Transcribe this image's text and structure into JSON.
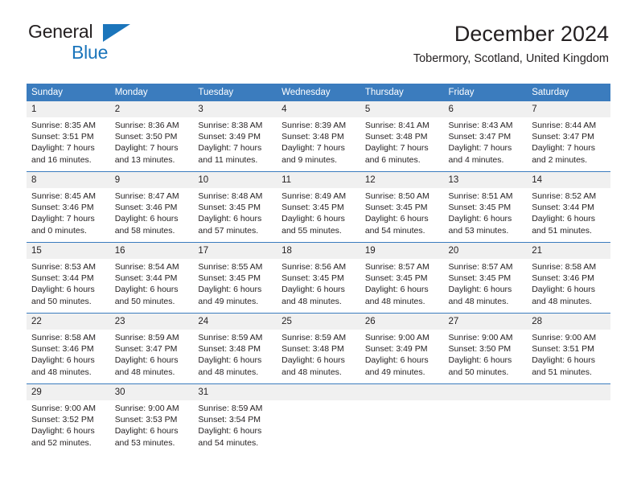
{
  "brand": {
    "name_part1": "General",
    "name_part2": "Blue",
    "accent_color": "#1b75bb"
  },
  "header": {
    "title": "December 2024",
    "subtitle": "Tobermory, Scotland, United Kingdom",
    "header_bg_color": "#3b7cbe",
    "daynum_bg_color": "#f0f0f0"
  },
  "weekdays": [
    "Sunday",
    "Monday",
    "Tuesday",
    "Wednesday",
    "Thursday",
    "Friday",
    "Saturday"
  ],
  "weeks": [
    {
      "days": [
        {
          "num": "1",
          "sunrise": "Sunrise: 8:35 AM",
          "sunset": "Sunset: 3:51 PM",
          "daylight_1": "Daylight: 7 hours",
          "daylight_2": "and 16 minutes."
        },
        {
          "num": "2",
          "sunrise": "Sunrise: 8:36 AM",
          "sunset": "Sunset: 3:50 PM",
          "daylight_1": "Daylight: 7 hours",
          "daylight_2": "and 13 minutes."
        },
        {
          "num": "3",
          "sunrise": "Sunrise: 8:38 AM",
          "sunset": "Sunset: 3:49 PM",
          "daylight_1": "Daylight: 7 hours",
          "daylight_2": "and 11 minutes."
        },
        {
          "num": "4",
          "sunrise": "Sunrise: 8:39 AM",
          "sunset": "Sunset: 3:48 PM",
          "daylight_1": "Daylight: 7 hours",
          "daylight_2": "and 9 minutes."
        },
        {
          "num": "5",
          "sunrise": "Sunrise: 8:41 AM",
          "sunset": "Sunset: 3:48 PM",
          "daylight_1": "Daylight: 7 hours",
          "daylight_2": "and 6 minutes."
        },
        {
          "num": "6",
          "sunrise": "Sunrise: 8:43 AM",
          "sunset": "Sunset: 3:47 PM",
          "daylight_1": "Daylight: 7 hours",
          "daylight_2": "and 4 minutes."
        },
        {
          "num": "7",
          "sunrise": "Sunrise: 8:44 AM",
          "sunset": "Sunset: 3:47 PM",
          "daylight_1": "Daylight: 7 hours",
          "daylight_2": "and 2 minutes."
        }
      ]
    },
    {
      "days": [
        {
          "num": "8",
          "sunrise": "Sunrise: 8:45 AM",
          "sunset": "Sunset: 3:46 PM",
          "daylight_1": "Daylight: 7 hours",
          "daylight_2": "and 0 minutes."
        },
        {
          "num": "9",
          "sunrise": "Sunrise: 8:47 AM",
          "sunset": "Sunset: 3:46 PM",
          "daylight_1": "Daylight: 6 hours",
          "daylight_2": "and 58 minutes."
        },
        {
          "num": "10",
          "sunrise": "Sunrise: 8:48 AM",
          "sunset": "Sunset: 3:45 PM",
          "daylight_1": "Daylight: 6 hours",
          "daylight_2": "and 57 minutes."
        },
        {
          "num": "11",
          "sunrise": "Sunrise: 8:49 AM",
          "sunset": "Sunset: 3:45 PM",
          "daylight_1": "Daylight: 6 hours",
          "daylight_2": "and 55 minutes."
        },
        {
          "num": "12",
          "sunrise": "Sunrise: 8:50 AM",
          "sunset": "Sunset: 3:45 PM",
          "daylight_1": "Daylight: 6 hours",
          "daylight_2": "and 54 minutes."
        },
        {
          "num": "13",
          "sunrise": "Sunrise: 8:51 AM",
          "sunset": "Sunset: 3:45 PM",
          "daylight_1": "Daylight: 6 hours",
          "daylight_2": "and 53 minutes."
        },
        {
          "num": "14",
          "sunrise": "Sunrise: 8:52 AM",
          "sunset": "Sunset: 3:44 PM",
          "daylight_1": "Daylight: 6 hours",
          "daylight_2": "and 51 minutes."
        }
      ]
    },
    {
      "days": [
        {
          "num": "15",
          "sunrise": "Sunrise: 8:53 AM",
          "sunset": "Sunset: 3:44 PM",
          "daylight_1": "Daylight: 6 hours",
          "daylight_2": "and 50 minutes."
        },
        {
          "num": "16",
          "sunrise": "Sunrise: 8:54 AM",
          "sunset": "Sunset: 3:44 PM",
          "daylight_1": "Daylight: 6 hours",
          "daylight_2": "and 50 minutes."
        },
        {
          "num": "17",
          "sunrise": "Sunrise: 8:55 AM",
          "sunset": "Sunset: 3:45 PM",
          "daylight_1": "Daylight: 6 hours",
          "daylight_2": "and 49 minutes."
        },
        {
          "num": "18",
          "sunrise": "Sunrise: 8:56 AM",
          "sunset": "Sunset: 3:45 PM",
          "daylight_1": "Daylight: 6 hours",
          "daylight_2": "and 48 minutes."
        },
        {
          "num": "19",
          "sunrise": "Sunrise: 8:57 AM",
          "sunset": "Sunset: 3:45 PM",
          "daylight_1": "Daylight: 6 hours",
          "daylight_2": "and 48 minutes."
        },
        {
          "num": "20",
          "sunrise": "Sunrise: 8:57 AM",
          "sunset": "Sunset: 3:45 PM",
          "daylight_1": "Daylight: 6 hours",
          "daylight_2": "and 48 minutes."
        },
        {
          "num": "21",
          "sunrise": "Sunrise: 8:58 AM",
          "sunset": "Sunset: 3:46 PM",
          "daylight_1": "Daylight: 6 hours",
          "daylight_2": "and 48 minutes."
        }
      ]
    },
    {
      "days": [
        {
          "num": "22",
          "sunrise": "Sunrise: 8:58 AM",
          "sunset": "Sunset: 3:46 PM",
          "daylight_1": "Daylight: 6 hours",
          "daylight_2": "and 48 minutes."
        },
        {
          "num": "23",
          "sunrise": "Sunrise: 8:59 AM",
          "sunset": "Sunset: 3:47 PM",
          "daylight_1": "Daylight: 6 hours",
          "daylight_2": "and 48 minutes."
        },
        {
          "num": "24",
          "sunrise": "Sunrise: 8:59 AM",
          "sunset": "Sunset: 3:48 PM",
          "daylight_1": "Daylight: 6 hours",
          "daylight_2": "and 48 minutes."
        },
        {
          "num": "25",
          "sunrise": "Sunrise: 8:59 AM",
          "sunset": "Sunset: 3:48 PM",
          "daylight_1": "Daylight: 6 hours",
          "daylight_2": "and 48 minutes."
        },
        {
          "num": "26",
          "sunrise": "Sunrise: 9:00 AM",
          "sunset": "Sunset: 3:49 PM",
          "daylight_1": "Daylight: 6 hours",
          "daylight_2": "and 49 minutes."
        },
        {
          "num": "27",
          "sunrise": "Sunrise: 9:00 AM",
          "sunset": "Sunset: 3:50 PM",
          "daylight_1": "Daylight: 6 hours",
          "daylight_2": "and 50 minutes."
        },
        {
          "num": "28",
          "sunrise": "Sunrise: 9:00 AM",
          "sunset": "Sunset: 3:51 PM",
          "daylight_1": "Daylight: 6 hours",
          "daylight_2": "and 51 minutes."
        }
      ]
    },
    {
      "days": [
        {
          "num": "29",
          "sunrise": "Sunrise: 9:00 AM",
          "sunset": "Sunset: 3:52 PM",
          "daylight_1": "Daylight: 6 hours",
          "daylight_2": "and 52 minutes."
        },
        {
          "num": "30",
          "sunrise": "Sunrise: 9:00 AM",
          "sunset": "Sunset: 3:53 PM",
          "daylight_1": "Daylight: 6 hours",
          "daylight_2": "and 53 minutes."
        },
        {
          "num": "31",
          "sunrise": "Sunrise: 8:59 AM",
          "sunset": "Sunset: 3:54 PM",
          "daylight_1": "Daylight: 6 hours",
          "daylight_2": "and 54 minutes."
        },
        {
          "num": "",
          "sunrise": "",
          "sunset": "",
          "daylight_1": "",
          "daylight_2": ""
        },
        {
          "num": "",
          "sunrise": "",
          "sunset": "",
          "daylight_1": "",
          "daylight_2": ""
        },
        {
          "num": "",
          "sunrise": "",
          "sunset": "",
          "daylight_1": "",
          "daylight_2": ""
        },
        {
          "num": "",
          "sunrise": "",
          "sunset": "",
          "daylight_1": "",
          "daylight_2": ""
        }
      ]
    }
  ]
}
